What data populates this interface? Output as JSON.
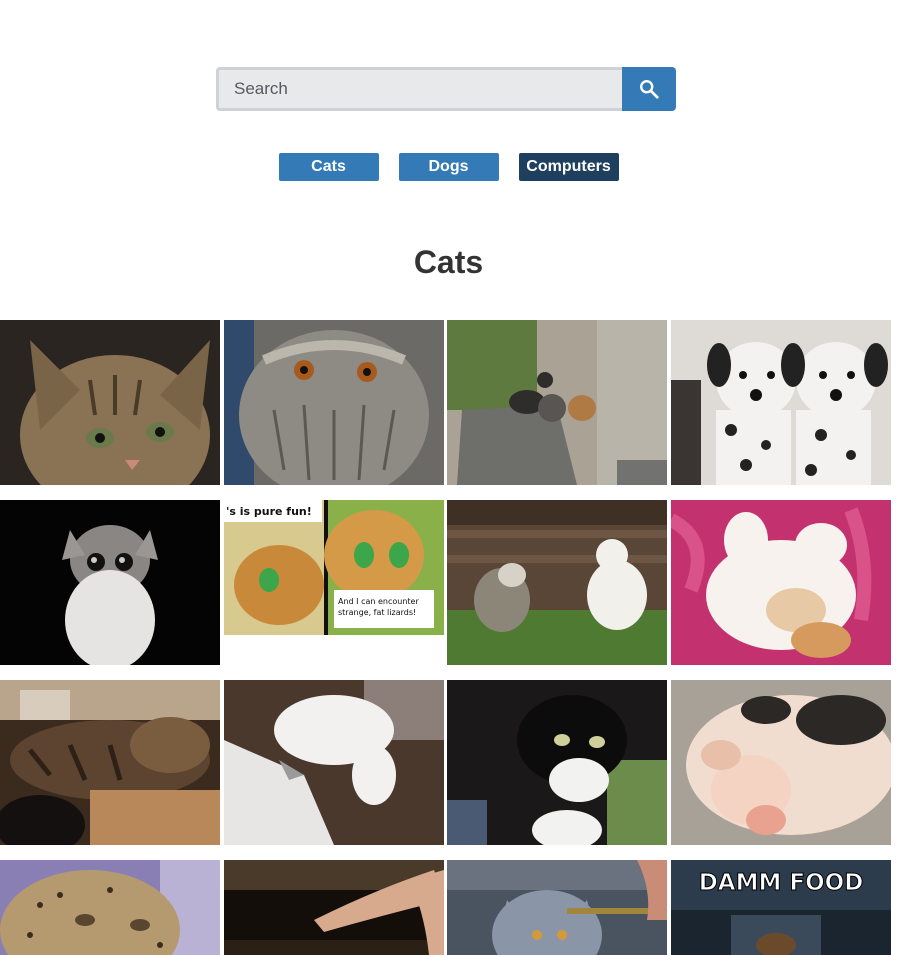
{
  "search": {
    "placeholder": "Search"
  },
  "categories": [
    {
      "label": "Cats",
      "active": false
    },
    {
      "label": "Dogs",
      "active": false
    },
    {
      "label": "Computers",
      "active": true
    }
  ],
  "heading": "Cats",
  "images": [
    {
      "name": "tabby-kitten-image"
    },
    {
      "name": "owl-image"
    },
    {
      "name": "cats-on-rocks-image"
    },
    {
      "name": "dalmatian-puppies-image"
    },
    {
      "name": "fluffy-kitten-image"
    },
    {
      "name": "cartoon-cats-comic-image",
      "caption_top": "'s is pure fun!",
      "caption_bottom": "And I can encounter strange, fat lizards!"
    },
    {
      "name": "cats-in-grass-image"
    },
    {
      "name": "sleeping-kitten-pink-blanket-image"
    },
    {
      "name": "sleeping-tabby-cat-image"
    },
    {
      "name": "white-cat-jumping-image"
    },
    {
      "name": "tuxedo-cat-image"
    },
    {
      "name": "sleeping-piglet-image"
    },
    {
      "name": "cheetah-image"
    },
    {
      "name": "hand-reaching-image"
    },
    {
      "name": "grey-cat-image"
    },
    {
      "name": "damm-food-meme-image",
      "caption_top": "DAMM FOOD"
    }
  ]
}
